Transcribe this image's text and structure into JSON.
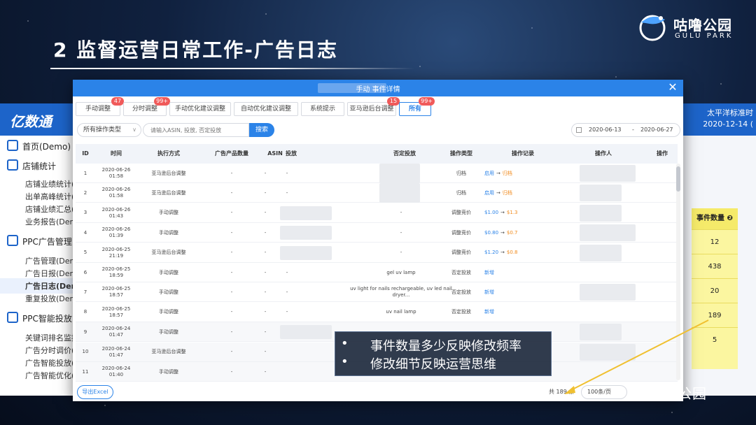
{
  "slide": {
    "title": "2  监督运营日常工作-广告日志"
  },
  "brand": {
    "name": "咕噜公园",
    "sub": "GULU PARK"
  },
  "bg_app": {
    "logo": "亿数通",
    "timezone": "太平洋标准时",
    "date": "2020-12-14 (",
    "sidebar": [
      {
        "label": "首页(Demo)",
        "type": "group"
      },
      {
        "label": "店铺统计",
        "type": "group"
      },
      {
        "label": "店铺业绩统计(D",
        "type": "sub"
      },
      {
        "label": "出单高峰统计(D",
        "type": "sub"
      },
      {
        "label": "店铺业绩汇总(D",
        "type": "sub"
      },
      {
        "label": "业务报告(Demo",
        "type": "sub"
      },
      {
        "label": "PPC广告管理",
        "type": "group"
      },
      {
        "label": "广告管理(Demo",
        "type": "sub"
      },
      {
        "label": "广告日报(Demo",
        "type": "sub"
      },
      {
        "label": "广告日志(Dem",
        "type": "sub",
        "active": true
      },
      {
        "label": "重复投放(Demo",
        "type": "sub"
      },
      {
        "label": "PPC智能投放",
        "type": "group"
      },
      {
        "label": "关键词排名监控",
        "type": "sub"
      },
      {
        "label": "广告分时调价(D",
        "type": "sub"
      },
      {
        "label": "广告智能投放(D",
        "type": "sub"
      },
      {
        "label": "广告智能优化(D",
        "type": "sub"
      }
    ],
    "event_count": {
      "header": "事件数量 ❷",
      "values": [
        "12",
        "438",
        "20",
        "189",
        "5"
      ]
    }
  },
  "modal": {
    "title": "手动 事件详情",
    "close": "✕",
    "tabs": [
      {
        "label": "手动调整",
        "badge": "47"
      },
      {
        "label": "分时调整",
        "badge": "99+"
      },
      {
        "label": "手动优化建议调整",
        "badge": ""
      },
      {
        "label": "自动优化建议调整",
        "badge": ""
      },
      {
        "label": "系统提示",
        "badge": ""
      },
      {
        "label": "亚马逊后台调整",
        "badge": "15"
      },
      {
        "label": "所有",
        "badge": "99+",
        "active": true
      }
    ],
    "filter_select": "所有操作类型",
    "search_placeholder": "请输入ASIN, 投放, 否定投放",
    "search_button": "搜索",
    "date_start": "2020-06-13",
    "date_sep": "-",
    "date_end": "2020-06-27",
    "columns": [
      "ID",
      "时间",
      "执行方式",
      "广告产品数量",
      "ASIN",
      "投放",
      "否定投放",
      "操作类型",
      "操作记录",
      "操作人",
      "操作"
    ],
    "rows": [
      {
        "id": "1",
        "time1": "2020-06-26",
        "time2": "01:58",
        "method": "亚马逊后台调整",
        "qty": "-",
        "asin": "-",
        "target": "-",
        "neg": "",
        "type": "归档",
        "from": "启用",
        "arrow": "→",
        "to": "归档",
        "new": ""
      },
      {
        "id": "2",
        "time1": "2020-06-26",
        "time2": "01:58",
        "method": "亚马逊后台调整",
        "qty": "-",
        "asin": "-",
        "target": "-",
        "neg": "",
        "type": "归档",
        "from": "启用",
        "arrow": "→",
        "to": "归档",
        "new": ""
      },
      {
        "id": "3",
        "time1": "2020-06-26",
        "time2": "01:43",
        "method": "手动调整",
        "qty": "-",
        "asin": "-",
        "target": "",
        "neg": "-",
        "type": "调整竞价",
        "from": "$1.00",
        "arrow": "→",
        "to": "$1.3",
        "new": ""
      },
      {
        "id": "4",
        "time1": "2020-06-26",
        "time2": "01:39",
        "method": "手动调整",
        "qty": "-",
        "asin": "-",
        "target": "",
        "neg": "-",
        "type": "调整竞价",
        "from": "$0.80",
        "arrow": "→",
        "to": "$0.7",
        "new": ""
      },
      {
        "id": "5",
        "time1": "2020-06-25",
        "time2": "21:19",
        "method": "亚马逊后台调整",
        "qty": "-",
        "asin": "-",
        "target": "",
        "neg": "-",
        "type": "调整竞价",
        "from": "$1.20",
        "arrow": "→",
        "to": "$0.8",
        "new": ""
      },
      {
        "id": "6",
        "time1": "2020-06-25",
        "time2": "18:59",
        "method": "手动调整",
        "qty": "-",
        "asin": "-",
        "target": "-",
        "neg": "gel uv lamp",
        "type": "否定投放",
        "from": "",
        "arrow": "",
        "to": "",
        "new": "新增"
      },
      {
        "id": "7",
        "time1": "2020-06-25",
        "time2": "18:57",
        "method": "手动调整",
        "qty": "-",
        "asin": "-",
        "target": "-",
        "neg": "uv light for nails rechargeable, uv led nail dryer...",
        "type": "否定投放",
        "from": "",
        "arrow": "",
        "to": "",
        "new": "新增"
      },
      {
        "id": "8",
        "time1": "2020-06-25",
        "time2": "18:57",
        "method": "手动调整",
        "qty": "-",
        "asin": "-",
        "target": "-",
        "neg": "uv nail lamp",
        "type": "否定投放",
        "from": "",
        "arrow": "",
        "to": "",
        "new": "新增"
      },
      {
        "id": "9",
        "time1": "2020-06-24",
        "time2": "01:47",
        "method": "手动调整",
        "qty": "-",
        "asin": "-",
        "target": "",
        "neg": "",
        "type": "",
        "from": "",
        "arrow": "",
        "to": "",
        "new": ""
      },
      {
        "id": "10",
        "time1": "2020-06-24",
        "time2": "01:47",
        "method": "亚马逊后台调整",
        "qty": "-",
        "asin": "-",
        "target": "",
        "neg": "",
        "type": "",
        "from": "",
        "arrow": "",
        "to": "",
        "new": ""
      },
      {
        "id": "11",
        "time1": "2020-06-24",
        "time2": "01:40",
        "method": "手动调整",
        "qty": "-",
        "asin": "-",
        "target": "",
        "neg": "",
        "type": "",
        "from": "",
        "arrow": "",
        "to": "",
        "new": ""
      }
    ],
    "export": "导出Excel",
    "total": "共 189 条",
    "page_size": "100条/页"
  },
  "callout": [
    {
      "bullet": "•",
      "text": "事件数量多少反映修改频率"
    },
    {
      "bullet": "•",
      "text": "修改细节反映运营思维"
    }
  ],
  "watermark": "咕噜公园",
  "colors": {
    "accent": "#2b83e8",
    "header": "#1d64c9",
    "highlight": "#fbf6a0",
    "arrow": "#f0c030"
  }
}
